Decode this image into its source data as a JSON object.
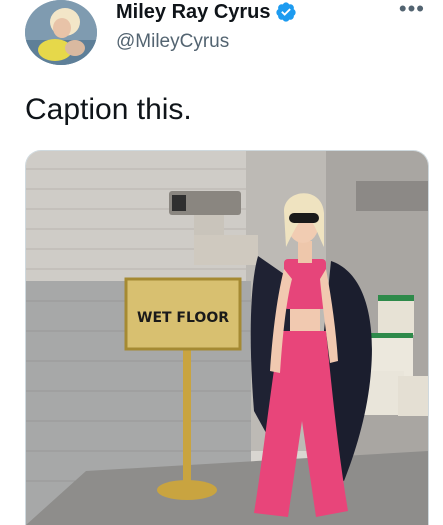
{
  "tweet": {
    "author_name": "Miley Ray Cyrus",
    "handle": "@MileyCyrus",
    "more_label": "•••",
    "text": "Caption this."
  },
  "media": {
    "sign_text": "WET FLOOR"
  },
  "colors": {
    "verified": "#1d9bf0",
    "name": "#0f1419",
    "handle": "#536471",
    "outfit": "#e8457a"
  }
}
